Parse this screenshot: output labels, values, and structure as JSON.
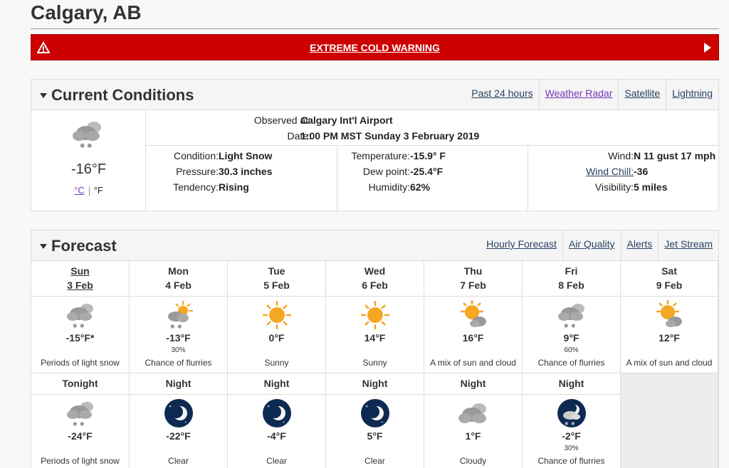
{
  "location": "Calgary, AB",
  "warning": {
    "text": "EXTREME COLD WARNING"
  },
  "current": {
    "title": "Current Conditions",
    "links": [
      "Past 24 hours",
      "Weather Radar",
      "Satellite",
      "Lightning"
    ],
    "temp": "-16°F",
    "unit_c": "°C",
    "unit_f": "°F",
    "icon": "light-snow-icon",
    "observed_label": "Observed at:",
    "observed_value": "Calgary Int'l Airport",
    "date_label": "Date:",
    "date_value": "1:00 PM MST Sunday 3 February 2019",
    "col1": [
      {
        "label": "Condition:",
        "value": "Light Snow"
      },
      {
        "label": "Pressure:",
        "value": "30.3 inches"
      },
      {
        "label": "Tendency:",
        "value": "Rising"
      }
    ],
    "col2": [
      {
        "label": "Temperature:",
        "value": "-15.9° F"
      },
      {
        "label": "Dew point:",
        "value": "-25.4°F"
      },
      {
        "label": "Humidity:",
        "value": "62%"
      }
    ],
    "col3": [
      {
        "label": "Wind:",
        "value": "N 11 gust 17 mph"
      },
      {
        "label": "Wind Chill:",
        "value": "-36"
      },
      {
        "label": "Visibility:",
        "value": "5 miles"
      }
    ]
  },
  "forecast": {
    "title": "Forecast",
    "links": [
      "Hourly Forecast",
      "Air Quality",
      "Alerts",
      "Jet Stream"
    ],
    "days": [
      {
        "day": "Sun",
        "date": "3 Feb",
        "icon": "snow",
        "temp": "-15°F*",
        "pop": "",
        "summary": "Periods of light snow"
      },
      {
        "day": "Mon",
        "date": "4 Feb",
        "icon": "sun-snow",
        "temp": "-13°F",
        "pop": "30%",
        "summary": "Chance of flurries"
      },
      {
        "day": "Tue",
        "date": "5 Feb",
        "icon": "sun",
        "temp": "0°F",
        "pop": "",
        "summary": "Sunny"
      },
      {
        "day": "Wed",
        "date": "6 Feb",
        "icon": "sun",
        "temp": "14°F",
        "pop": "",
        "summary": "Sunny"
      },
      {
        "day": "Thu",
        "date": "7 Feb",
        "icon": "sun-cloud",
        "temp": "16°F",
        "pop": "",
        "summary": "A mix of sun and cloud"
      },
      {
        "day": "Fri",
        "date": "8 Feb",
        "icon": "snow",
        "temp": "9°F",
        "pop": "60%",
        "summary": "Chance of flurries"
      },
      {
        "day": "Sat",
        "date": "9 Feb",
        "icon": "sun-cloud",
        "temp": "12°F",
        "pop": "",
        "summary": "A mix of sun and cloud"
      }
    ],
    "nights": [
      {
        "label": "Tonight",
        "icon": "snow",
        "temp": "-24°F",
        "pop": "",
        "summary": "Periods of light snow"
      },
      {
        "label": "Night",
        "icon": "moon",
        "temp": "-22°F",
        "pop": "",
        "summary": "Clear"
      },
      {
        "label": "Night",
        "icon": "moon",
        "temp": "-4°F",
        "pop": "",
        "summary": "Clear"
      },
      {
        "label": "Night",
        "icon": "moon",
        "temp": "5°F",
        "pop": "",
        "summary": "Clear"
      },
      {
        "label": "Night",
        "icon": "cloud",
        "temp": "1°F",
        "pop": "",
        "summary": "Cloudy"
      },
      {
        "label": "Night",
        "icon": "moon-snow",
        "temp": "-2°F",
        "pop": "30%",
        "summary": "Chance of flurries"
      }
    ]
  },
  "colors": {
    "warning": "#cc0000",
    "sun": "#f5a623",
    "night": "#0e2a52",
    "link": "#284162"
  }
}
